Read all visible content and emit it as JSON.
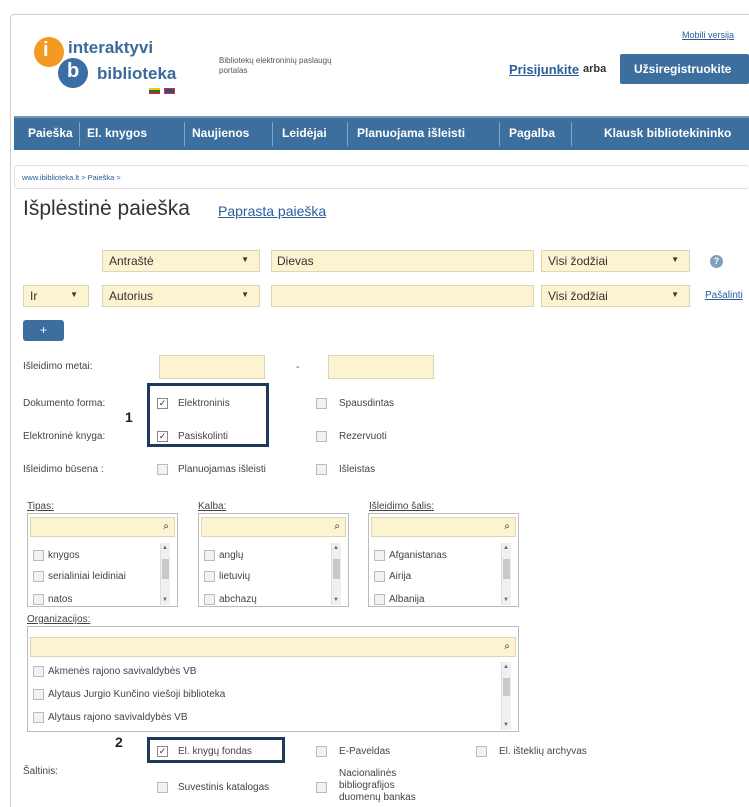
{
  "header": {
    "logo_line1": "interaktyvi",
    "logo_line2": "biblioteka",
    "logo_i": "i",
    "logo_b": "b",
    "tagline": "Bibliotekų elektroninių paslaugų portalas",
    "mobile_link": "Mobili versija",
    "login": "Prisijunkite",
    "or": "arba",
    "register": "Užsiregistruokite"
  },
  "nav": [
    "Paieška",
    "El. knygos",
    "Naujienos",
    "Leidėjai",
    "Planuojama išleisti",
    "Pagalba",
    "Klausk bibliotekininko"
  ],
  "breadcrumb": "www.ibiblioteka.lt > Paieška >",
  "page": {
    "title": "Išplėstinė paieška",
    "simple_search": "Paprasta paieška"
  },
  "search_rows": {
    "row1": {
      "field": "Antraštė",
      "value": "Dievas",
      "mode": "Visi žodžiai"
    },
    "row2": {
      "operator": "Ir",
      "field": "Autorius",
      "value": "",
      "mode": "Visi žodžiai"
    },
    "help": "?",
    "remove": "Pašalinti",
    "add": "+"
  },
  "filters": {
    "year_label": "Išleidimo metai:",
    "year_sep": "-",
    "doc_form_label": "Dokumento forma:",
    "electronic": "Elektroninis",
    "printed": "Spausdintas",
    "ebook_label": "Elektroninė knyga:",
    "borrow": "Pasiskolinti",
    "reserve": "Rezervuoti",
    "status_label": "Išleidimo būsena :",
    "planned": "Planuojamas išleisti",
    "published": "Išleistas",
    "annotation1": "1",
    "annotation2": "2"
  },
  "lists": {
    "type_label": "Tipas:",
    "types": [
      "knygos",
      "serialiniai leidiniai",
      "natos"
    ],
    "lang_label": "Kalba:",
    "langs": [
      "anglų",
      "lietuvių",
      "abchazų"
    ],
    "country_label": "Išleidimo šalis:",
    "countries": [
      "Afganistanas",
      "Airija",
      "Albanija"
    ],
    "org_label": "Organizacijos:",
    "orgs": [
      "Akmenės rajono savivaldybės VB",
      "Alytaus Jurgio Kunčino viešoji biblioteka",
      "Alytaus rajono savivaldybės VB"
    ]
  },
  "sources": {
    "label": "Šaltinis:",
    "ebook_fund": "El. knygų fondas",
    "epaveldas": "E-Paveldas",
    "archive": "El. išteklių archyvas",
    "union_catalog": "Suvestinis katalogas",
    "national_db": "Nacionalinės bibliografijos duomenų bankas"
  },
  "colors": {
    "nav": "#3d6f9e",
    "input": "#fcf3d0",
    "link": "#2a5d9b",
    "highlight": "#1f3a5a"
  }
}
